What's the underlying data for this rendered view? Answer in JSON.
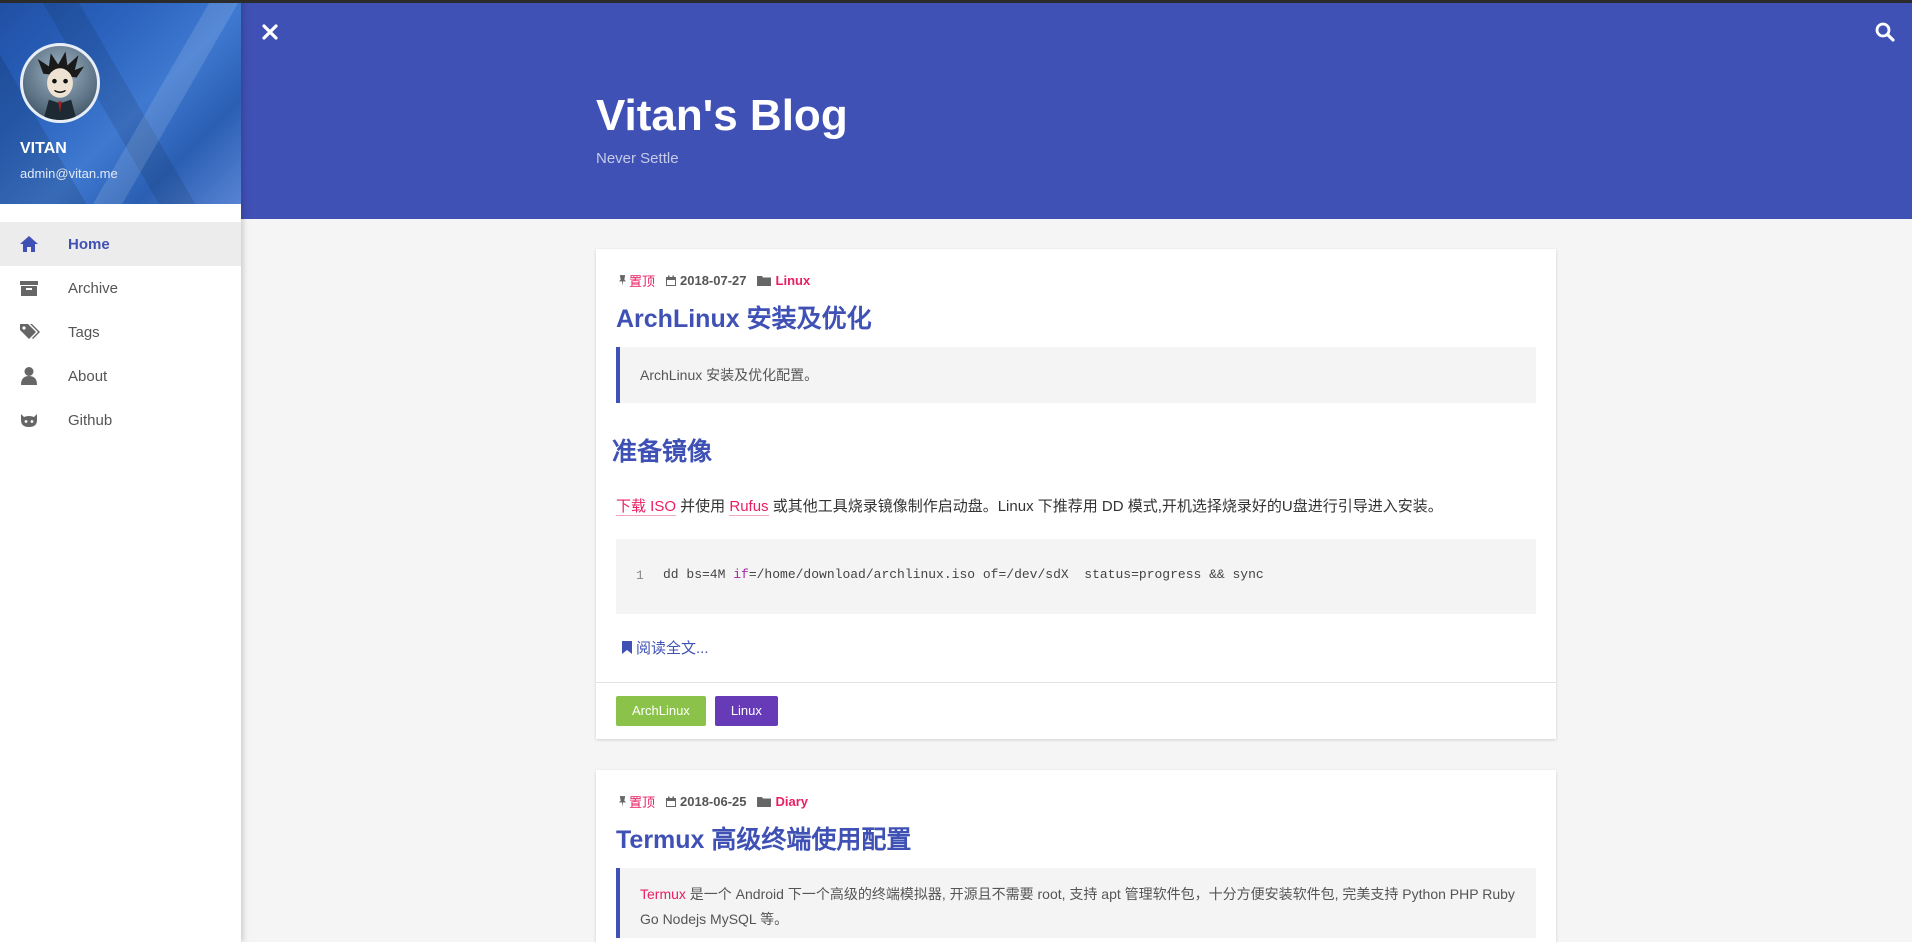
{
  "sidebar": {
    "name": "VITAN",
    "email": "admin@vitan.me",
    "items": [
      {
        "label": "Home",
        "icon": "home-icon",
        "active": true
      },
      {
        "label": "Archive",
        "icon": "archive-icon"
      },
      {
        "label": "Tags",
        "icon": "tags-icon"
      },
      {
        "label": "About",
        "icon": "user-icon"
      },
      {
        "label": "Github",
        "icon": "github-icon"
      }
    ]
  },
  "header": {
    "title": "Vitan's Blog",
    "subtitle": "Never Settle",
    "close_icon": "close-icon",
    "search_icon": "search-icon"
  },
  "colors": {
    "primary": "#3f51b5",
    "accent": "#e91e63",
    "tag_archlinux": "#8bc34a",
    "tag_linux": "#673ab7"
  },
  "posts": [
    {
      "pin": "置顶",
      "date": "2018-07-27",
      "category": "Linux",
      "title": "ArchLinux 安装及优化",
      "summary": "ArchLinux 安装及优化配置。",
      "heading": "准备镜像",
      "para_link1": "下载 ISO",
      "para_text1": " 并使用 ",
      "para_link2": "Rufus",
      "para_text2": " 或其他工具烧录镜像制作启动盘。Linux 下推荐用 DD 模式,开机选择烧录好的U盘进行引导进入安装。",
      "code_line_no": "1",
      "code_pre": "dd bs=4M ",
      "code_kw": "if",
      "code_post": "=/home/download/archlinux.iso of=/dev/sdX  status=progress && sync",
      "read_more": "阅读全文...",
      "tags": [
        "ArchLinux",
        "Linux"
      ]
    },
    {
      "pin": "置顶",
      "date": "2018-06-25",
      "category": "Diary",
      "title": "Termux 高级终端使用配置",
      "summary_link": "Termux",
      "summary_line1": " 是一个 Android 下一个高级的终端模拟器, 开源且不需要 root, 支持 apt 管理软件包，十分方便安装软件包, 完美支持 Python PHP Ruby",
      "summary_line2": "Go Nodejs MySQL 等。"
    }
  ]
}
